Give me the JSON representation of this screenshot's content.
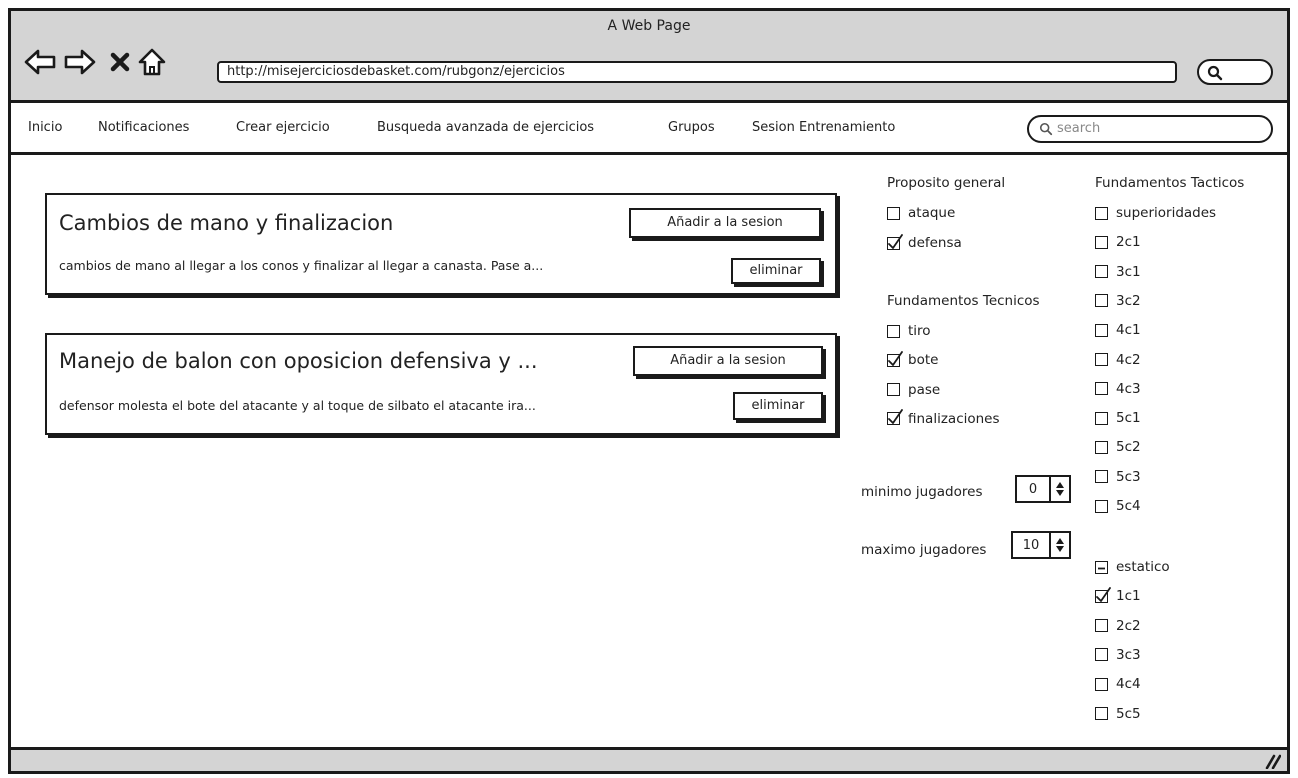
{
  "window": {
    "title": "A Web Page"
  },
  "browser": {
    "url": "http://misejerciciosdebasket.com/rubgonz/ejercicios",
    "buttons": {
      "back": "back-arrow-icon",
      "forward": "forward-arrow-icon",
      "stop": "close-icon",
      "home": "home-icon"
    }
  },
  "menu": {
    "items": [
      "Inicio",
      "Notificaciones",
      "Crear ejercicio",
      "Busqueda avanzada de ejercicios",
      "Grupos",
      "Sesion Entrenamiento"
    ],
    "search_placeholder": "search"
  },
  "exercises": [
    {
      "title": "Cambios de mano y finalizacion",
      "description": "cambios de mano al llegar a los conos y finalizar al llegar a canasta. Pase a...",
      "add_label": "Añadir a la sesion",
      "delete_label": "eliminar"
    },
    {
      "title": "Manejo de balon con oposicion defensiva y ...",
      "description": "defensor molesta el bote del atacante y al toque de silbato el atacante ira...",
      "add_label": "Añadir a la sesion",
      "delete_label": "eliminar"
    }
  ],
  "filters": {
    "proposito": {
      "title": "Proposito general",
      "options": [
        {
          "label": "ataque",
          "state": "unchecked"
        },
        {
          "label": "defensa",
          "state": "checked"
        }
      ]
    },
    "tecnicos": {
      "title": "Fundamentos Tecnicos",
      "options": [
        {
          "label": "tiro",
          "state": "unchecked"
        },
        {
          "label": "bote",
          "state": "checked"
        },
        {
          "label": "pase",
          "state": "unchecked"
        },
        {
          "label": "finalizaciones",
          "state": "checked"
        }
      ]
    },
    "min_players": {
      "label": "minimo jugadores",
      "value": "0"
    },
    "max_players": {
      "label": "maximo jugadores",
      "value": "10"
    },
    "tacticos": {
      "title": "Fundamentos Tacticos",
      "superioridades": [
        {
          "label": "superioridades",
          "state": "unchecked"
        },
        {
          "label": "2c1",
          "state": "unchecked"
        },
        {
          "label": "3c1",
          "state": "unchecked"
        },
        {
          "label": "3c2",
          "state": "unchecked"
        },
        {
          "label": "4c1",
          "state": "unchecked"
        },
        {
          "label": "4c2",
          "state": "unchecked"
        },
        {
          "label": "4c3",
          "state": "unchecked"
        },
        {
          "label": "5c1",
          "state": "unchecked"
        },
        {
          "label": "5c2",
          "state": "unchecked"
        },
        {
          "label": "5c3",
          "state": "unchecked"
        },
        {
          "label": "5c4",
          "state": "unchecked"
        }
      ],
      "estatico": [
        {
          "label": "estatico",
          "state": "indeterminate"
        },
        {
          "label": "1c1",
          "state": "checked"
        },
        {
          "label": "2c2",
          "state": "unchecked"
        },
        {
          "label": "3c3",
          "state": "unchecked"
        },
        {
          "label": "4c4",
          "state": "unchecked"
        },
        {
          "label": "5c5",
          "state": "unchecked"
        }
      ]
    }
  }
}
